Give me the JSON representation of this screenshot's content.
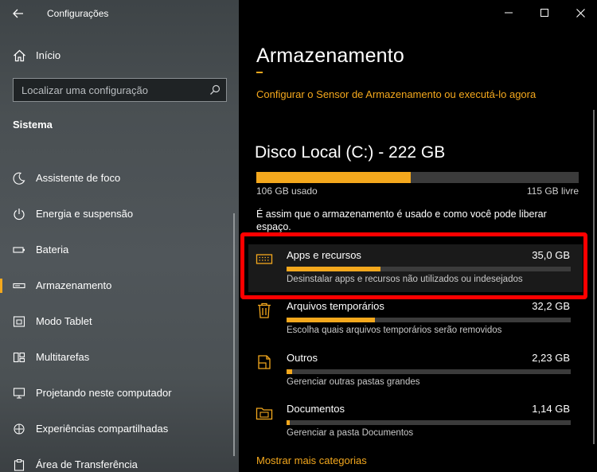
{
  "window": {
    "app_title": "Configurações",
    "accent_color": "#f4a81d",
    "highlight_color": "#ff0000"
  },
  "sidebar": {
    "home_label": "Início",
    "search_placeholder": "Localizar uma configuração",
    "section_title": "Sistema",
    "items": [
      {
        "label": "Assistente de foco",
        "icon": "moon-icon"
      },
      {
        "label": "Energia e suspensão",
        "icon": "power-icon"
      },
      {
        "label": "Bateria",
        "icon": "battery-icon"
      },
      {
        "label": "Armazenamento",
        "icon": "storage-icon",
        "selected": true
      },
      {
        "label": "Modo Tablet",
        "icon": "tablet-icon"
      },
      {
        "label": "Multitarefas",
        "icon": "multitasking-icon"
      },
      {
        "label": "Projetando neste computador",
        "icon": "projecting-icon"
      },
      {
        "label": "Experiências compartilhadas",
        "icon": "shared-experiences-icon"
      },
      {
        "label": "Área de Transferência",
        "icon": "clipboard-icon"
      }
    ]
  },
  "main": {
    "title": "Armazenamento",
    "sensor_link": "Configurar o Sensor de Armazenamento ou executá-lo agora",
    "disk": {
      "title": "Disco Local (C:) - 222 GB",
      "used_label": "106 GB usado",
      "free_label": "115 GB livre",
      "used_fraction": 0.48
    },
    "description": "É assim que o armazenamento é usado e como você pode liberar espaço.",
    "categories": [
      {
        "name": "Apps e recursos",
        "size": "35,0 GB",
        "desc": "Desinstalar apps e recursos não utilizados ou indesejados",
        "fraction": 0.33,
        "icon": "apps-icon"
      },
      {
        "name": "Arquivos temporários",
        "size": "32,2 GB",
        "desc": "Escolha quais arquivos temporários serão removidos",
        "fraction": 0.31,
        "icon": "trash-icon"
      },
      {
        "name": "Outros",
        "size": "2,23 GB",
        "desc": "Gerenciar outras pastas grandes",
        "fraction": 0.02,
        "icon": "document-icon"
      },
      {
        "name": "Documentos",
        "size": "1,14 GB",
        "desc": "Gerenciar a pasta Documentos",
        "fraction": 0.01,
        "icon": "folder-icon"
      }
    ],
    "show_more": "Mostrar mais categorias"
  }
}
